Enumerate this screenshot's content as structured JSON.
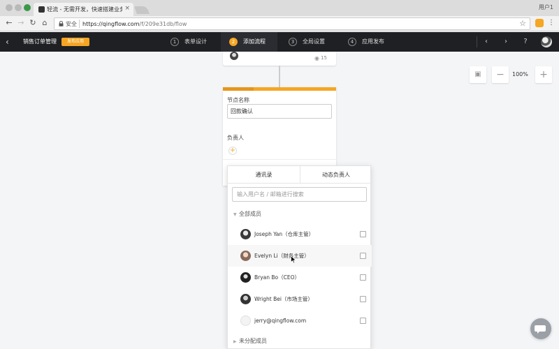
{
  "browser": {
    "tab_title": "轻流 - 无需开发，快速搭建业务",
    "tab_close": "×",
    "user_label": "用户1",
    "secure_label": "安全",
    "url_host": "https://qingflow.com",
    "url_path": "/f/209e31db/flow"
  },
  "header": {
    "app_title": "销售订单管理",
    "publish_badge": "发布应用",
    "steps": [
      {
        "num": "1",
        "label": "表单设计"
      },
      {
        "num": "2",
        "label": "添加流程"
      },
      {
        "num": "3",
        "label": "全局设置"
      },
      {
        "num": "4",
        "label": "应用发布"
      }
    ],
    "active_step_index": 1
  },
  "canvas": {
    "prev_node_view_count": "15",
    "node": {
      "name_label": "节点名称",
      "name_value": "回款确认",
      "assignee_label": "负责人",
      "add_symbol": "+"
    },
    "zoom_level": "100%",
    "zoom_out_symbol": "−",
    "zoom_in_symbol": "+"
  },
  "picker": {
    "tabs": [
      "通讯录",
      "动态负责人"
    ],
    "search_placeholder": "输入用户名 / 邮箱进行搜索",
    "group_all": "全部成员",
    "members": [
      {
        "name": "Joseph Yan（仓库主管）",
        "hovered": false
      },
      {
        "name": "Evelyn Li（财务主管）",
        "hovered": true
      },
      {
        "name": "Bryan Bo（CEO）",
        "hovered": false
      },
      {
        "name": "Wright Bei（市场主管）",
        "hovered": false
      },
      {
        "name": "jerry@qingflow.com",
        "hovered": false
      }
    ],
    "group_unassigned": "未分配成员"
  }
}
